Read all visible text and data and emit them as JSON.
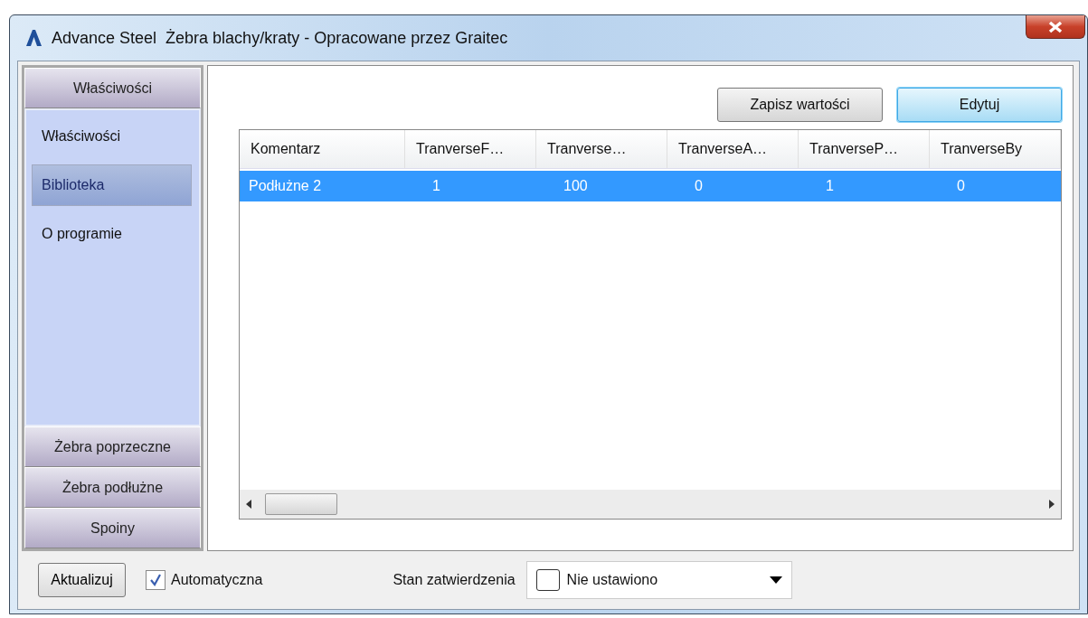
{
  "window": {
    "app": "Advance Steel",
    "title": "Żebra blachy/kraty - Opracowane przez Graitec"
  },
  "sidebar": {
    "sections": [
      {
        "label": "Właściwości",
        "items": [
          {
            "label": "Właściwości",
            "selected": false
          },
          {
            "label": "Biblioteka",
            "selected": true
          },
          {
            "label": "O programie",
            "selected": false
          }
        ]
      },
      {
        "label": "Żebra poprzeczne"
      },
      {
        "label": "Żebra podłużne"
      },
      {
        "label": "Spoiny"
      }
    ]
  },
  "toolbar": {
    "buttons": [
      {
        "label": "Zapisz wartości",
        "focused": false
      },
      {
        "label": "Edytuj",
        "focused": true
      }
    ]
  },
  "table": {
    "columns": [
      "Komentarz",
      "TranverseF…",
      "Tranverse…",
      "TranverseA…",
      "TranverseP…",
      "TranverseBy"
    ],
    "rows": [
      {
        "cells": [
          "Podłużne 2",
          "1",
          "100",
          "0",
          "1",
          "0"
        ],
        "selected": true
      }
    ]
  },
  "footer": {
    "update_button": "Aktualizuj",
    "auto_checkbox": {
      "label": "Automatyczna",
      "checked": true
    },
    "status_label": "Stan zatwierdzenia",
    "status_dropdown": {
      "value": "Nie ustawiono"
    }
  }
}
